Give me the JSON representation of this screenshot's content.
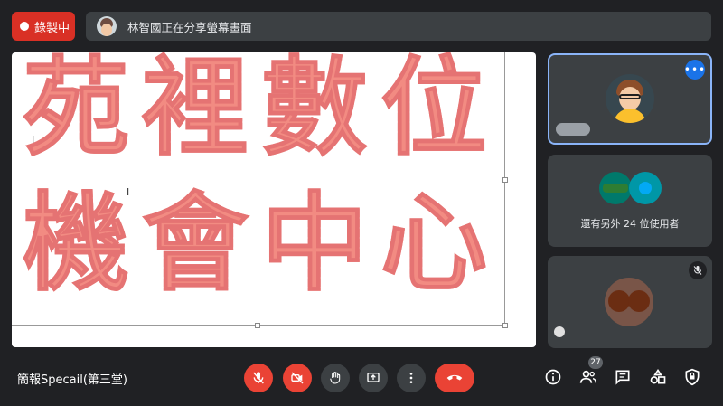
{
  "recording": {
    "label": "錄製中"
  },
  "share_banner": {
    "text": "林智國正在分享螢幕畫面"
  },
  "slide": {
    "line1": "苑裡數位",
    "line2": "機會中心"
  },
  "participants": {
    "others_label": "還有另外 24 位使用者",
    "more_label": "•••"
  },
  "meeting": {
    "title": "簡報Specail(第三堂)"
  },
  "people_count": "27",
  "colors": {
    "record_red": "#d93025",
    "accent_blue": "#1a73e8",
    "ctrl_red": "#ea4335",
    "slide_text": "#f28b82"
  },
  "icons": [
    "mic-off-icon",
    "camera-off-icon",
    "raise-hand-icon",
    "present-icon",
    "more-vert-icon",
    "call-end-icon",
    "info-icon",
    "people-icon",
    "chat-icon",
    "activities-icon",
    "host-controls-icon",
    "mute-icon"
  ]
}
